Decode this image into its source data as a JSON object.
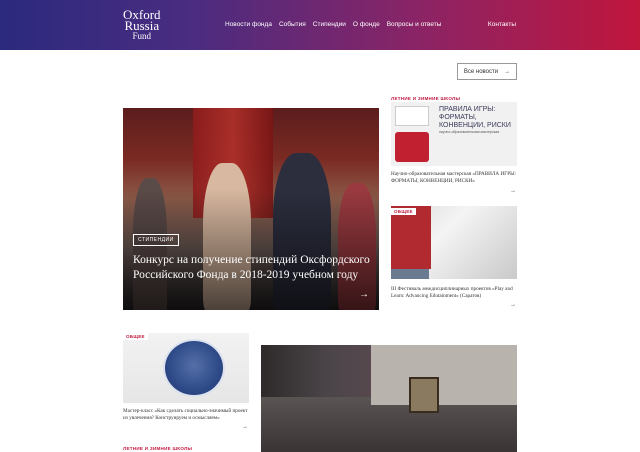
{
  "header": {
    "logo": {
      "line1": "Oxford",
      "line2": "Russia",
      "line3": "Fund"
    },
    "nav": [
      {
        "label": "Новости фонда"
      },
      {
        "label": "События"
      },
      {
        "label": "Стипендии"
      },
      {
        "label": "О фонде"
      },
      {
        "label": "Вопросы и ответы"
      }
    ],
    "contacts": "Контакты"
  },
  "all_news": {
    "label": "Все новости",
    "icon": "arrow-right-icon"
  },
  "hero": {
    "tag": "СТИПЕНДИИ",
    "title": "Конкурс на получение стипендий Оксфордского Российского Фонда в 2018-2019 учебном году",
    "arrow": "→"
  },
  "right_cards": [
    {
      "category": "ЛЕТНИЕ И ЗИМНИЕ ШКОЛЫ",
      "image_title": "ПРАВИЛА ИГРЫ: ФОРМАТЫ, КОНВЕНЦИИ, РИСКИ",
      "image_subtitle": "научно-образовательная мастерская",
      "text": "Научно-образовательная мастерская «ПРАВИЛА ИГРЫ: ФОРМАТЫ, КОНВЕНЦИИ, РИСКИ»",
      "arrow": "→"
    },
    {
      "category": "ОБЩЕЕ",
      "text": "III Фестиваль междисциплинарных проектов «Play and Learn: Advancing Edutainment» (Саратов)",
      "arrow": "→"
    }
  ],
  "bottom_cards": [
    {
      "category": "ОБЩЕЕ",
      "text": "Мастер-класс «Как сделать социально-значимый проект из увлечения? Конструируем и осмысляем»",
      "arrow": "→"
    },
    {
      "category": "ЛЕТНИЕ И ЗИМНИЕ ШКОЛЫ"
    }
  ],
  "colors": {
    "accent": "#c0163c",
    "header_start": "#2b2a7e",
    "header_end": "#c0163c"
  }
}
